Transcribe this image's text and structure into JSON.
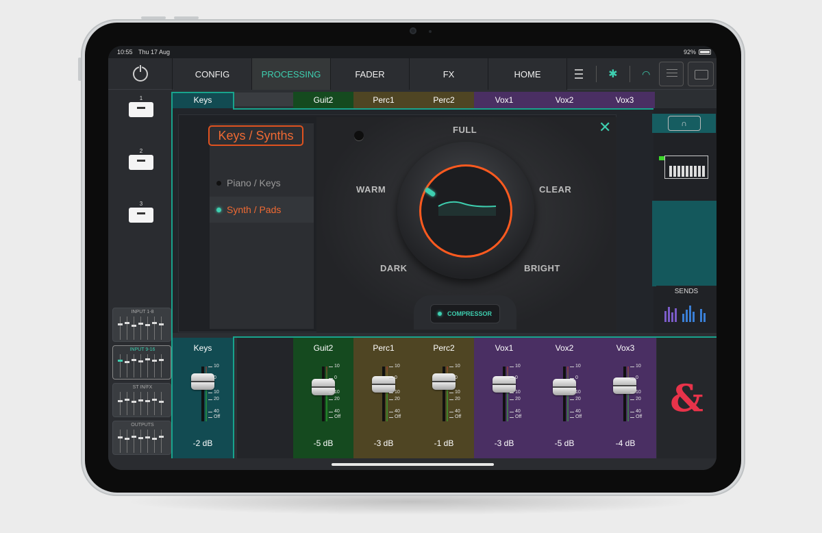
{
  "status": {
    "time": "10:55",
    "date": "Thu 17 Aug",
    "battery": "92%"
  },
  "nav": {
    "tabs": [
      {
        "label": "CONFIG",
        "active": false
      },
      {
        "label": "PROCESSING",
        "active": true
      },
      {
        "label": "FADER",
        "active": false
      },
      {
        "label": "FX",
        "active": false
      },
      {
        "label": "HOME",
        "active": false
      }
    ]
  },
  "scenes": [
    "1",
    "2",
    "3"
  ],
  "banks": [
    "INPUT 1-8",
    "INPUT 9-16",
    "ST IN/FX",
    "OUTPUTS"
  ],
  "channel_tabs": [
    "Keys",
    "Guit2",
    "Perc1",
    "Perc2",
    "Vox1",
    "Vox2",
    "Vox3"
  ],
  "preset": {
    "title": "Keys / Synths",
    "items": [
      {
        "label": "Piano / Keys",
        "active": false
      },
      {
        "label": "Synth / Pads",
        "active": true
      }
    ]
  },
  "knob": {
    "labels": {
      "full": "FULL",
      "warm": "WARM",
      "clear": "CLEAR",
      "dark": "DARK",
      "bright": "BRIGHT"
    },
    "compressor_label": "COMPRESSOR",
    "compressor_on": true
  },
  "right": {
    "headphones_icon": "headphones-icon",
    "instrument_icon": "keyboard-icon",
    "sends_label": "SENDS"
  },
  "strips": [
    {
      "name": "Keys",
      "db": "-2 dB",
      "color": "#124b52"
    },
    {
      "name": "Guit2",
      "db": "-5 dB",
      "color": "#154a1f"
    },
    {
      "name": "Perc1",
      "db": "-3 dB",
      "color": "#4f4523"
    },
    {
      "name": "Perc2",
      "db": "-1 dB",
      "color": "#4f4523"
    },
    {
      "name": "Vox1",
      "db": "-3 dB",
      "color": "#4a2f63"
    },
    {
      "name": "Vox2",
      "db": "-5 dB",
      "color": "#4a2f63"
    },
    {
      "name": "Vox3",
      "db": "-4 dB",
      "color": "#4a2f63"
    }
  ],
  "fader_scale": [
    "10",
    "0",
    "10",
    "20",
    "40",
    "Off"
  ],
  "brand_logo": "&",
  "colors": {
    "accent": "#3ecfb0",
    "orange": "#f06a33",
    "keys": "#124b52",
    "guitar": "#154a1f",
    "perc": "#4f4523",
    "vox": "#4a2f63"
  }
}
